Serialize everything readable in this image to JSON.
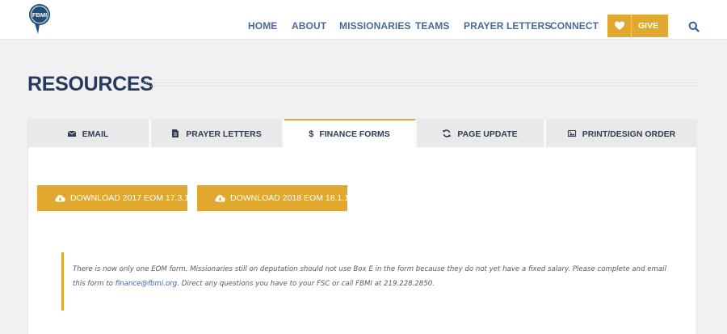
{
  "header": {
    "logo_text": "FBMI",
    "nav": [
      {
        "label": "HOME"
      },
      {
        "label": "ABOUT"
      },
      {
        "label": "MISSIONARIES"
      },
      {
        "label": "TEAMS"
      },
      {
        "label": "PRAYER LETTERS"
      },
      {
        "label": "CONNECT"
      }
    ],
    "give_label": "GIVE",
    "give_icon": "heart-icon",
    "search_icon": "search-icon"
  },
  "page": {
    "title": "RESOURCES"
  },
  "tabs": [
    {
      "label": "EMAIL",
      "icon": "envelope-icon",
      "active": false
    },
    {
      "label": "PRAYER LETTERS",
      "icon": "document-icon",
      "active": false
    },
    {
      "label": "FINANCE FORMS",
      "icon": "dollar-icon",
      "active": true
    },
    {
      "label": "PAGE UPDATE",
      "icon": "refresh-icon",
      "active": false
    },
    {
      "label": "PRINT/DESIGN ORDER",
      "icon": "image-icon",
      "active": false
    }
  ],
  "downloads": [
    {
      "label": "DOWNLOAD 2017 EOM 17.3.1",
      "icon": "cloud-download-icon"
    },
    {
      "label": "DOWNLOAD 2018 EOM 18.1.1",
      "icon": "cloud-download-icon"
    }
  ],
  "notice": {
    "text_before": "There is now only one EOM form. Missionaries still on deputation should not use Box E in the form because they do not yet have a fixed salary. Please complete and email this form to ",
    "email": "finance@fbmi.org",
    "text_after": ". Direct any questions you have to your FSC or call FBMI at 219.228.2850."
  },
  "colors": {
    "accent": "#e0a82e",
    "nav_text": "#4a6a98",
    "title": "#243a5e"
  }
}
